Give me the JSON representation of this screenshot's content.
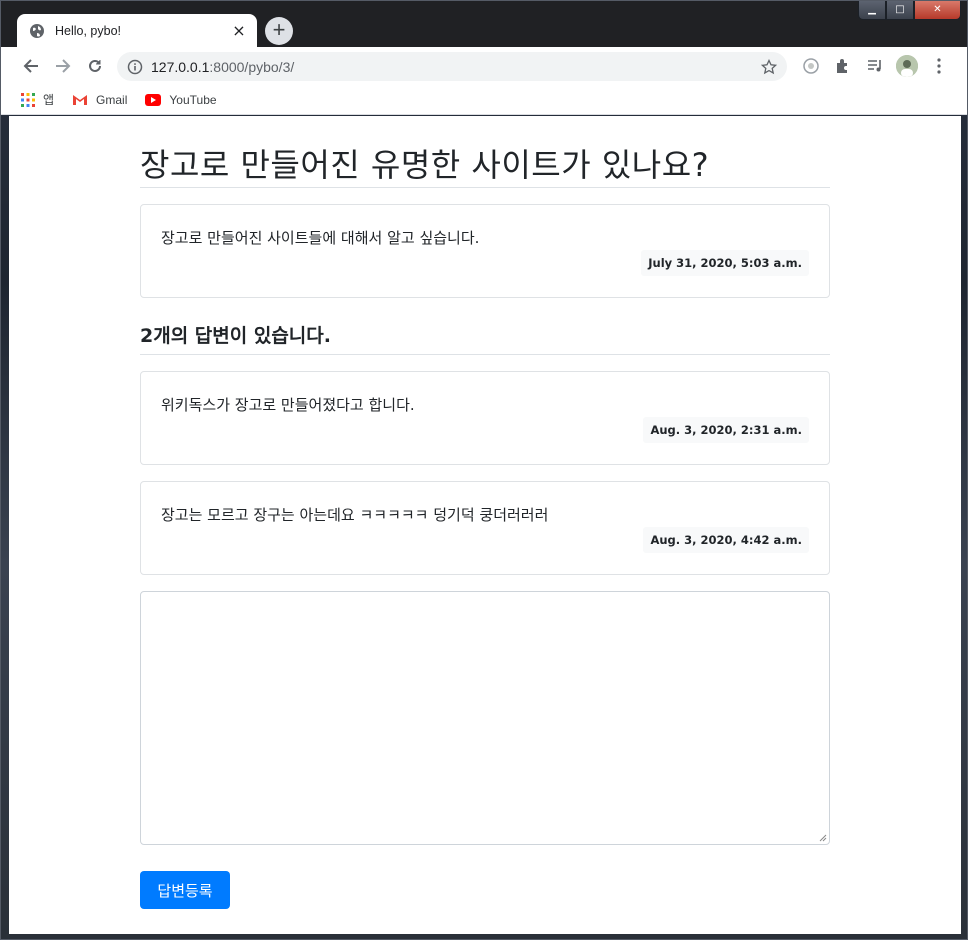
{
  "browser": {
    "tab_title": "Hello, pybo!",
    "tab_close": "×",
    "new_tab": "+",
    "url_host": "127.0.0.1",
    "url_rest": ":8000/pybo/3/",
    "bookmarks": [
      {
        "label": "앱",
        "icon": "apps-grid-icon"
      },
      {
        "label": "Gmail",
        "icon": "gmail-icon"
      },
      {
        "label": "YouTube",
        "icon": "youtube-icon"
      }
    ]
  },
  "question": {
    "title": "장고로 만들어진 유명한 사이트가 있나요?",
    "content": "장고로 만들어진 사이트들에 대해서 알고 싶습니다.",
    "date": "July 31, 2020, 5:03 a.m."
  },
  "answers_header": "2개의 답변이 있습니다.",
  "answers": [
    {
      "content": "위키독스가 장고로 만들어졌다고 합니다.",
      "date": "Aug. 3, 2020, 2:31 a.m."
    },
    {
      "content": "장고는 모르고 장구는 아는데요 ㅋㅋㅋㅋㅋ 덩기덕 쿵더러러러",
      "date": "Aug. 3, 2020, 4:42 a.m."
    }
  ],
  "answer_form": {
    "textarea_value": "",
    "submit_label": "답변등록"
  },
  "colors": {
    "primary": "#007bff",
    "chrome_dark": "#202124"
  }
}
